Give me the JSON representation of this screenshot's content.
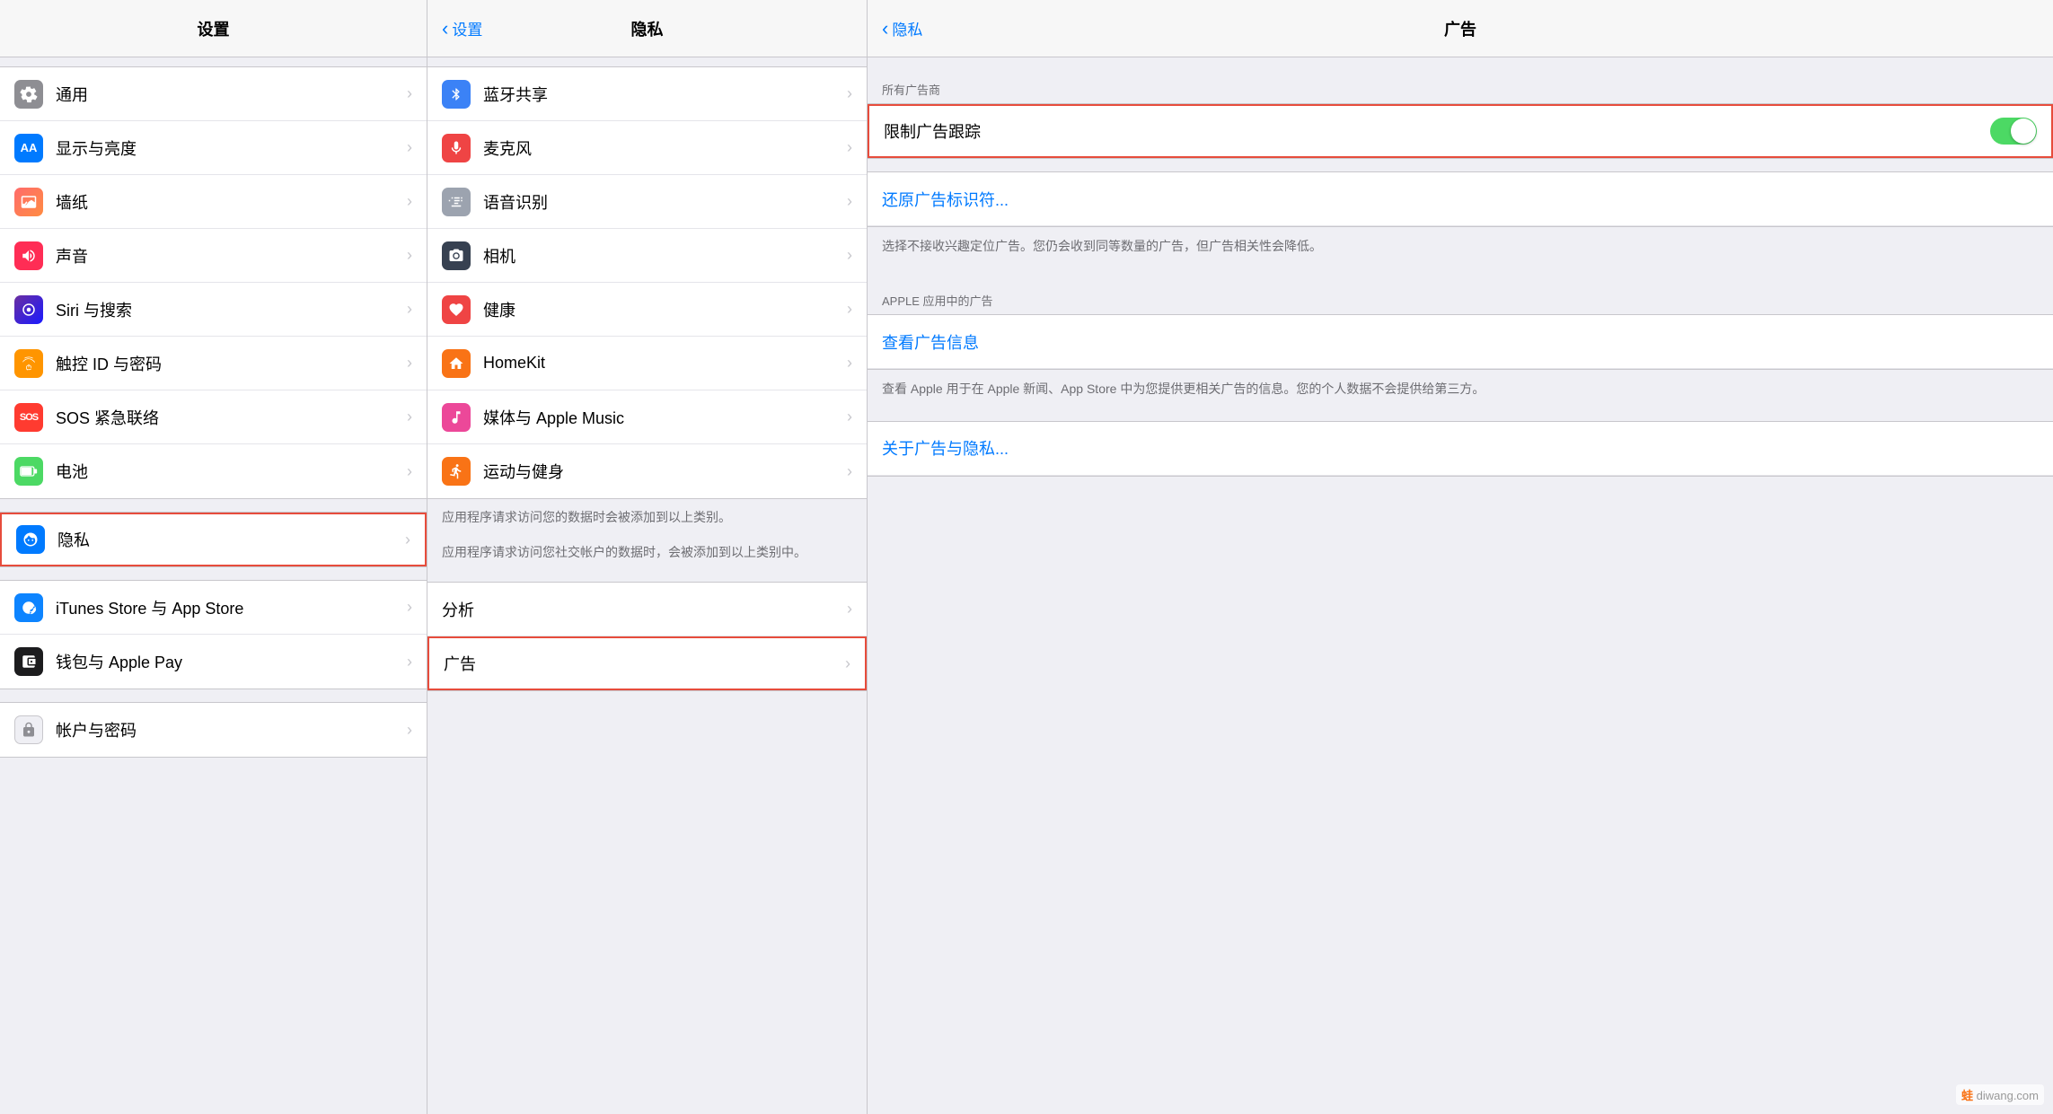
{
  "panel1": {
    "title": "设置",
    "items": [
      {
        "id": "general",
        "label": "通用",
        "iconBg": "icon-gear",
        "iconChar": "⚙",
        "hasChevron": true,
        "highlighted": false
      },
      {
        "id": "display",
        "label": "显示与亮度",
        "iconBg": "icon-display",
        "iconChar": "AA",
        "hasChevron": true,
        "highlighted": false
      },
      {
        "id": "wallpaper",
        "label": "墙纸",
        "iconBg": "icon-wallpaper",
        "iconChar": "❋",
        "hasChevron": true,
        "highlighted": false
      },
      {
        "id": "sound",
        "label": "声音",
        "iconBg": "icon-sound",
        "iconChar": "🔊",
        "hasChevron": true,
        "highlighted": false
      },
      {
        "id": "siri",
        "label": "Siri 与搜索",
        "iconBg": "icon-siri",
        "iconChar": "◉",
        "hasChevron": true,
        "highlighted": false
      },
      {
        "id": "touchid",
        "label": "触控 ID 与密码",
        "iconBg": "icon-touch",
        "iconChar": "☞",
        "hasChevron": true,
        "highlighted": false
      },
      {
        "id": "sos",
        "label": "SOS 紧急联络",
        "iconBg": "icon-sos",
        "iconChar": "SOS",
        "hasChevron": true,
        "highlighted": false,
        "iconFontSize": "11px"
      },
      {
        "id": "battery",
        "label": "电池",
        "iconBg": "icon-battery",
        "iconChar": "▬",
        "hasChevron": true,
        "highlighted": false
      },
      {
        "id": "privacy",
        "label": "隐私",
        "iconBg": "icon-privacy",
        "iconChar": "✋",
        "hasChevron": true,
        "highlighted": true
      },
      {
        "id": "itunes",
        "label": "iTunes Store 与 App Store",
        "iconBg": "icon-itunes",
        "iconChar": "⬇",
        "hasChevron": true,
        "highlighted": false
      },
      {
        "id": "wallet",
        "label": "钱包与 Apple Pay",
        "iconBg": "icon-wallet",
        "iconChar": "▪",
        "hasChevron": true,
        "highlighted": false
      },
      {
        "id": "account",
        "label": "帐户与密码",
        "iconBg": "icon-account",
        "iconChar": "◎",
        "hasChevron": true,
        "highlighted": false
      }
    ]
  },
  "panel2": {
    "title": "隐私",
    "backLabel": "设置",
    "items": [
      {
        "id": "bluetooth",
        "label": "蓝牙共享",
        "iconBg": "#3b82f6",
        "iconType": "bluetooth",
        "hasChevron": true
      },
      {
        "id": "microphone",
        "label": "麦克风",
        "iconBg": "#ef4444",
        "iconType": "mic",
        "hasChevron": true
      },
      {
        "id": "speech",
        "label": "语音识别",
        "iconBg": "#9ca3af",
        "iconType": "wave",
        "hasChevron": true
      },
      {
        "id": "camera",
        "label": "相机",
        "iconBg": "#374151",
        "iconType": "camera",
        "hasChevron": true
      },
      {
        "id": "health",
        "label": "健康",
        "iconBg": "#ef4444",
        "iconType": "heart",
        "hasChevron": true
      },
      {
        "id": "homekit",
        "label": "HomeKit",
        "iconBg": "#f97316",
        "iconType": "home",
        "hasChevron": true
      },
      {
        "id": "media",
        "label": "媒体与 Apple Music",
        "iconBg": "#ec4899",
        "iconType": "music",
        "hasChevron": true
      },
      {
        "id": "motion",
        "label": "运动与健身",
        "iconBg": "#f97316",
        "iconType": "motion",
        "hasChevron": true
      }
    ],
    "note1": "应用程序请求访问您的数据时会被添加到以上类别。",
    "note2": "应用程序请求访问您社交帐户的数据时，会被添加到以上类别中。",
    "section2": [
      {
        "id": "analytics",
        "label": "分析",
        "hasChevron": true,
        "highlighted": false
      },
      {
        "id": "ads",
        "label": "广告",
        "hasChevron": true,
        "highlighted": true
      }
    ]
  },
  "panel3": {
    "title": "广告",
    "backLabel": "隐私",
    "sectionLabel1": "所有广告商",
    "limitAdTrackingLabel": "限制广告跟踪",
    "limitAdTrackingOn": true,
    "resetLabel": "还原广告标识符...",
    "desc1": "选择不接收兴趣定位广告。您仍会收到同等数量的广告，但广告相关性会降低。",
    "sectionLabel2": "APPLE 应用中的广告",
    "viewAdInfoLabel": "查看广告信息",
    "desc2": "查看 Apple 用于在 Apple 新闻、App Store 中为您提供更相关广告的信息。您的个人数据不会提供给第三方。",
    "aboutAdLabel": "关于广告与隐私..."
  },
  "watermark": "diwang.com"
}
